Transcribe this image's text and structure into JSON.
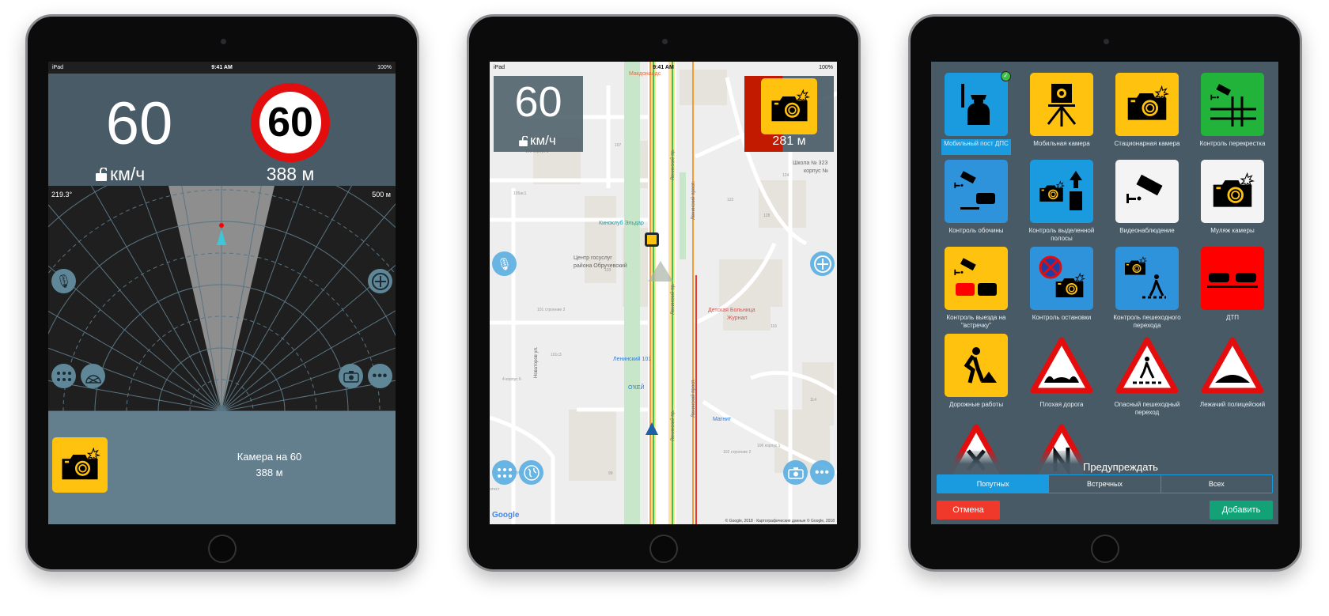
{
  "colors": {
    "accent": "#1a9be0",
    "panel": "#485b67",
    "camera_yellow": "#ffc20e",
    "alert_red": "#c11a00",
    "cancel": "#f0392b",
    "add": "#12a275"
  },
  "status_bar": {
    "device": "iPad",
    "time": "9:41 AM",
    "battery": "100%"
  },
  "radar_screen": {
    "speed": "60",
    "unit": "км/ч",
    "limit_sign": "60",
    "distance": "388 м",
    "heading": "219.3°",
    "range": "500 м",
    "alert_title": "Камера на 60",
    "alert_distance": "388 м",
    "icons": [
      "microphone-icon",
      "plus-circle-icon",
      "grid-menu-icon",
      "radar-icon",
      "camera-icon",
      "more-icon"
    ]
  },
  "map_screen": {
    "speed": "60",
    "unit": "км/ч",
    "camera_distance": "281 м",
    "labels": [
      {
        "text": "Макдоналдс",
        "kind": "poi-orange"
      },
      {
        "text": "Киноклуб Эльдар",
        "kind": "poi-teal"
      },
      {
        "text": "Центр госуслуг",
        "kind": "poi-gray"
      },
      {
        "text": "района Обручевский",
        "kind": "poi-gray"
      },
      {
        "text": "Школа № 323",
        "kind": "poi-gray"
      },
      {
        "text": "корпус №",
        "kind": "poi-gray"
      },
      {
        "text": "Детская Больница",
        "kind": "poi-red"
      },
      {
        "text": "Журнал",
        "kind": "poi-red"
      },
      {
        "text": "Ленинский 101",
        "kind": "poi-blue"
      },
      {
        "text": "О'КЕЙ",
        "kind": "poi-blue"
      },
      {
        "text": "Магнит",
        "kind": "poi-blue"
      },
      {
        "text": "107",
        "kind": "bldg"
      },
      {
        "text": "109 корпус 1",
        "kind": "bldg"
      },
      {
        "text": "105ас1",
        "kind": "bldg"
      },
      {
        "text": "103",
        "kind": "bldg"
      },
      {
        "text": "101 строение 2",
        "kind": "bldg"
      },
      {
        "text": "101с3",
        "kind": "bldg"
      },
      {
        "text": "4 корпус 6",
        "kind": "bldg"
      },
      {
        "text": "4 корпус 4",
        "kind": "bldg"
      },
      {
        "text": "99",
        "kind": "bldg"
      },
      {
        "text": "122",
        "kind": "bldg"
      },
      {
        "text": "128",
        "kind": "bldg"
      },
      {
        "text": "124",
        "kind": "bldg"
      },
      {
        "text": "116",
        "kind": "bldg"
      },
      {
        "text": "114",
        "kind": "bldg"
      },
      {
        "text": "102 строение 2",
        "kind": "bldg"
      },
      {
        "text": "106 корпус 1",
        "kind": "bldg"
      },
      {
        "text": "отест",
        "kind": "bldg"
      }
    ],
    "streets": {
      "main": "Ленинский пр.",
      "side": "Ленинский просп.",
      "novatorov": "Новаторов ул."
    },
    "google_logo": "Google",
    "attribution": "© Google, 2018 · Картографические данные © Google, 2018"
  },
  "types_screen": {
    "items": [
      {
        "label": "Мобильный пост ДПС",
        "bg": "#1a9be0",
        "glyph": "police",
        "selected": true
      },
      {
        "label": "Мобильная камера",
        "bg": "#ffc20e",
        "glyph": "tripod"
      },
      {
        "label": "Стационарная камера",
        "bg": "#ffc20e",
        "glyph": "camera"
      },
      {
        "label": "Контроль перекрестка",
        "bg": "#22b33a",
        "glyph": "crossroad"
      },
      {
        "label": "Контроль обочины",
        "bg": "#2f93dc",
        "glyph": "shoulder"
      },
      {
        "label": "Контроль выделенной полосы",
        "bg": "#1a9be0",
        "glyph": "buslane"
      },
      {
        "label": "Видеонаблюдение",
        "bg": "#f4f4f4",
        "glyph": "cctv"
      },
      {
        "label": "Муляж камеры",
        "bg": "#f4f4f4",
        "glyph": "camera"
      },
      {
        "label": "Контроль выезда на \"встречку\"",
        "bg": "#ffc20e",
        "glyph": "oncoming"
      },
      {
        "label": "Контроль остановки",
        "bg": "#2f93dc",
        "glyph": "nostop"
      },
      {
        "label": "Контроль пешеходного перехода",
        "bg": "#2f93dc",
        "glyph": "pedcam"
      },
      {
        "label": "ДТП",
        "bg": "#ff0000",
        "glyph": "crash"
      },
      {
        "label": "Дорожные работы",
        "bg": "#ffc20e",
        "glyph": "worker"
      },
      {
        "label": "Плохая дорога",
        "bg": "none",
        "glyph": "tri-bumps"
      },
      {
        "label": "Опасный пешеходный переход",
        "bg": "none",
        "glyph": "tri-ped"
      },
      {
        "label": "Лежачий полицейский",
        "bg": "none",
        "glyph": "tri-bump"
      },
      {
        "label": "",
        "bg": "none",
        "glyph": "tri-cross"
      },
      {
        "label": "",
        "bg": "none",
        "glyph": "tri-curve"
      }
    ],
    "warn_label": "Предупреждать",
    "segments": [
      {
        "label": "Попутных",
        "active": true
      },
      {
        "label": "Встречных"
      },
      {
        "label": "Всех"
      }
    ],
    "cancel": "Отмена",
    "add": "Добавить"
  }
}
